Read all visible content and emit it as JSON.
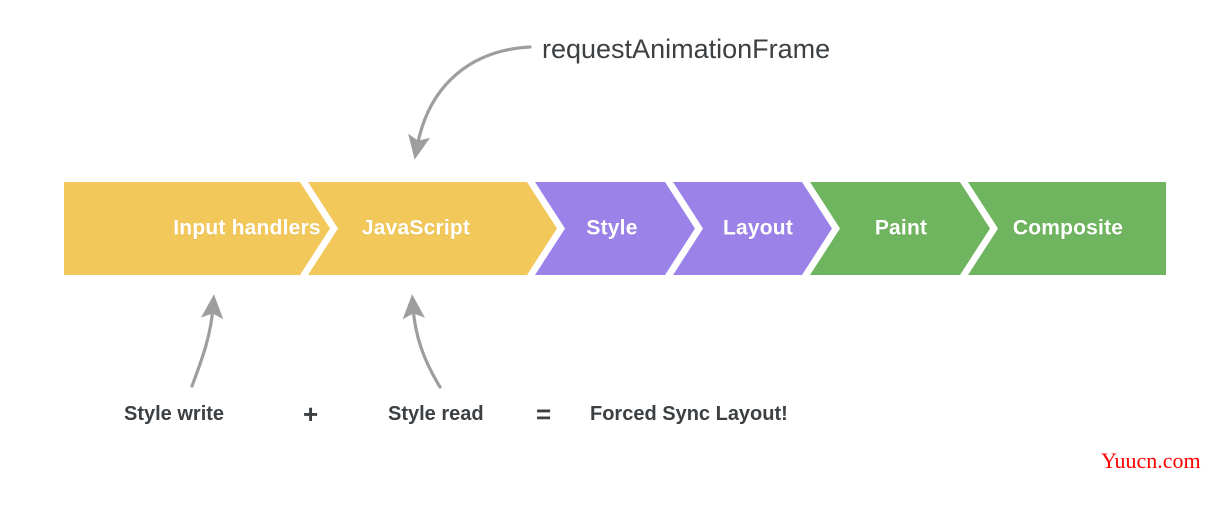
{
  "diagram": {
    "title_annotation": "requestAnimationFrame",
    "watermark": "Yuucn.com",
    "pipeline": {
      "segments": [
        {
          "label": "Input handlers",
          "color": "#F2C85B",
          "group": "javascript"
        },
        {
          "label": "JavaScript",
          "color": "#F2C85B",
          "group": "javascript"
        },
        {
          "label": "Style",
          "color": "#9B82E8",
          "group": "style-layout"
        },
        {
          "label": "Layout",
          "color": "#9B82E8",
          "group": "style-layout"
        },
        {
          "label": "Paint",
          "color": "#6FB45E",
          "group": "paint-composite"
        },
        {
          "label": "Composite",
          "color": "#6FB45E",
          "group": "paint-composite"
        }
      ]
    },
    "equation": {
      "left_term": "Style write",
      "plus": "+",
      "right_term": "Style read",
      "equals": "=",
      "result": "Forced Sync Layout!"
    },
    "colors": {
      "yellow": "#F2C85B",
      "purple": "#9B82E8",
      "green": "#6FB45E",
      "arrow_gray": "#9e9e9e",
      "text_dark": "#3c4043",
      "watermark_red": "#ff0000"
    }
  },
  "chart_data": {
    "type": "diagram",
    "title": "Browser rendering pipeline (pixel pipeline)",
    "categories": [
      "Input handlers",
      "JavaScript",
      "Style",
      "Layout",
      "Paint",
      "Composite"
    ],
    "annotations": [
      {
        "text": "requestAnimationFrame",
        "points_to": "JavaScript"
      },
      {
        "text": "Style write",
        "points_to": "Input handlers"
      },
      {
        "text": "Style read",
        "points_to": "JavaScript"
      },
      {
        "text": "Forced Sync Layout!",
        "points_to": null
      }
    ]
  }
}
